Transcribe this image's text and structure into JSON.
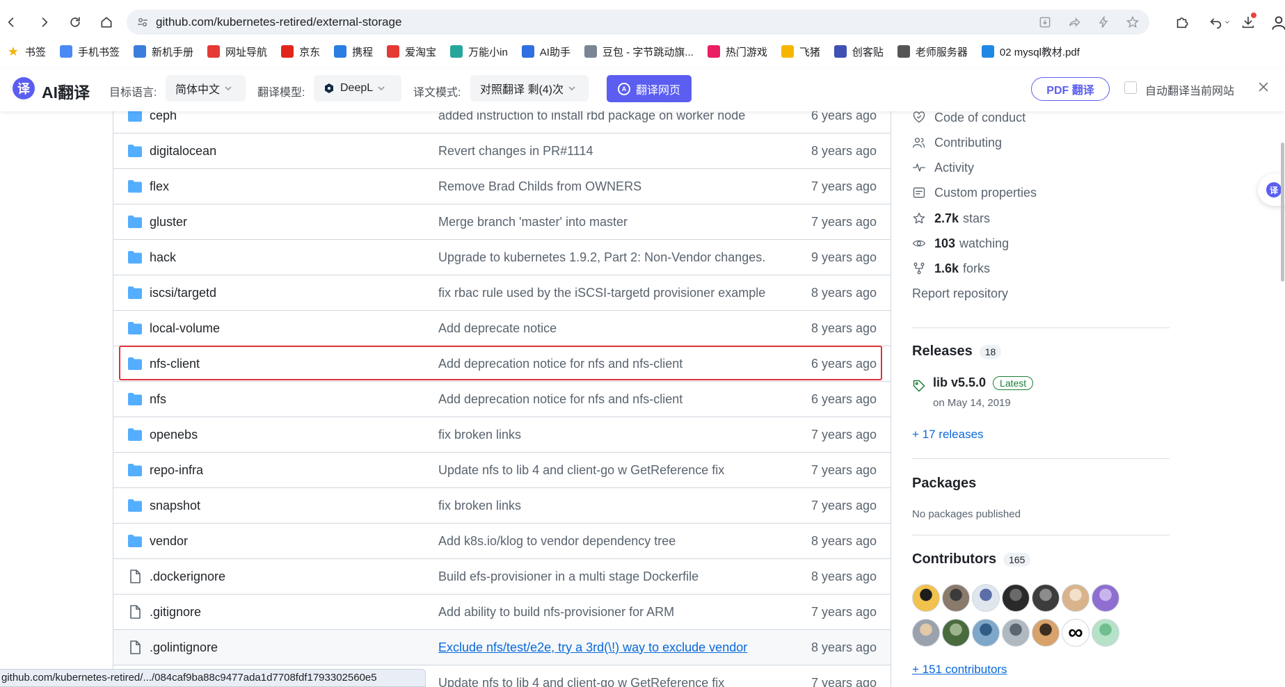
{
  "browser": {
    "url": "github.com/kubernetes-retired/external-storage",
    "status_url": "github.com/kubernetes-retired/.../084caf9ba88c9477ada1d7708fdf1793302560e5"
  },
  "bookmarks": [
    {
      "label": "书签",
      "icon": "star-icon",
      "color": "#f4b400"
    },
    {
      "label": "手机书签",
      "icon": "phone-bookmark-icon",
      "color": "#4a8af4"
    },
    {
      "label": "新机手册",
      "icon": "manual-icon",
      "color": "#3b7ddd"
    },
    {
      "label": "网址导航",
      "icon": "nav-icon",
      "color": "#e53935"
    },
    {
      "label": "京东",
      "icon": "jd-icon",
      "color": "#e1251b"
    },
    {
      "label": "携程",
      "icon": "ctrip-icon",
      "color": "#2a7de1"
    },
    {
      "label": "爱淘宝",
      "icon": "taobao-icon",
      "color": "#e53935"
    },
    {
      "label": "万能小in",
      "icon": "in-icon",
      "color": "#26a69a"
    },
    {
      "label": "AI助手",
      "icon": "ai-icon",
      "color": "#2f6fdf"
    },
    {
      "label": "豆包 - 字节跳动旗...",
      "icon": "doubao-icon",
      "color": "#7a8596"
    },
    {
      "label": "热门游戏",
      "icon": "game-icon",
      "color": "#e91e63"
    },
    {
      "label": "飞猪",
      "icon": "fliggy-icon",
      "color": "#f6b600"
    },
    {
      "label": "创客贴",
      "icon": "chuangke-icon",
      "color": "#3f51b5"
    },
    {
      "label": "老师服务器",
      "icon": "server-icon",
      "color": "#555555"
    },
    {
      "label": "02 mysql教材.pdf",
      "icon": "edge-icon",
      "color": "#1e88e5"
    }
  ],
  "translate": {
    "brand": "AI翻译",
    "target_lang_label": "目标语言:",
    "target_lang_value": "简体中文",
    "model_label": "翻译模型:",
    "model_value": "DeepL",
    "mode_label": "译文模式:",
    "mode_value": "对照翻译 剩(4)次",
    "translate_button": "翻译网页",
    "pdf_button": "PDF 翻译",
    "auto_label": "自动翻译当前网站",
    "accent": "#5b5ef0"
  },
  "files": [
    {
      "name": "ceph",
      "type": "folder",
      "message": "added instruction to install rbd package on worker node",
      "age": "6 years ago"
    },
    {
      "name": "digitalocean",
      "type": "folder",
      "message": "Revert changes in PR#1114",
      "age": "8 years ago"
    },
    {
      "name": "flex",
      "type": "folder",
      "message": "Remove Brad Childs from OWNERS",
      "age": "7 years ago"
    },
    {
      "name": "gluster",
      "type": "folder",
      "message": "Merge branch 'master' into master",
      "age": "7 years ago"
    },
    {
      "name": "hack",
      "type": "folder",
      "message": "Upgrade to kubernetes 1.9.2, Part 2: Non-Vendor changes.",
      "age": "9 years ago"
    },
    {
      "name": "iscsi/targetd",
      "type": "folder",
      "message": "fix rbac rule used by the iSCSI-targetd provisioner example",
      "age": "8 years ago"
    },
    {
      "name": "local-volume",
      "type": "folder",
      "message": "Add deprecate notice",
      "age": "8 years ago"
    },
    {
      "name": "nfs-client",
      "type": "folder",
      "message": "Add deprecation notice for nfs and nfs-client",
      "age": "6 years ago"
    },
    {
      "name": "nfs",
      "type": "folder",
      "message": "Add deprecation notice for nfs and nfs-client",
      "age": "6 years ago"
    },
    {
      "name": "openebs",
      "type": "folder",
      "message": "fix broken links",
      "age": "7 years ago"
    },
    {
      "name": "repo-infra",
      "type": "folder",
      "message": "Update nfs to lib 4 and client-go w GetReference fix",
      "age": "7 years ago"
    },
    {
      "name": "snapshot",
      "type": "folder",
      "message": "fix broken links",
      "age": "7 years ago"
    },
    {
      "name": "vendor",
      "type": "folder",
      "message": "Add k8s.io/klog to vendor dependency tree",
      "age": "8 years ago"
    },
    {
      "name": ".dockerignore",
      "type": "file",
      "message": "Build efs-provisioner in a multi stage Dockerfile",
      "age": "8 years ago"
    },
    {
      "name": ".gitignore",
      "type": "file",
      "message": "Add ability to build nfs-provisioner for ARM",
      "age": "7 years ago"
    },
    {
      "name": ".golintignore",
      "type": "file",
      "message": "Exclude nfs/test/e2e, try a 3rd(\\!) way to exclude vendor",
      "age": "8 years ago"
    },
    {
      "name": "",
      "type": "file",
      "message": "Update nfs to lib 4 and client-go w GetReference fix",
      "age": "7 years ago"
    }
  ],
  "sidebar": {
    "links": [
      {
        "label": "Code of conduct",
        "icon": "heart-shield-icon"
      },
      {
        "label": "Contributing",
        "icon": "people-icon"
      },
      {
        "label": "Activity",
        "icon": "pulse-icon"
      },
      {
        "label": "Custom properties",
        "icon": "note-icon"
      },
      {
        "label": "stars",
        "count": "2.7k",
        "icon": "star-icon"
      },
      {
        "label": "watching",
        "count": "103",
        "icon": "eye-icon"
      },
      {
        "label": "forks",
        "count": "1.6k",
        "icon": "fork-icon"
      }
    ],
    "report": "Report repository",
    "releases_title": "Releases",
    "releases_count": "18",
    "release_name": "lib v5.5.0",
    "release_badge": "Latest",
    "release_date": "on May 14, 2019",
    "more_releases": "+ 17 releases",
    "packages_title": "Packages",
    "packages_text": "No packages published",
    "contributors_title": "Contributors",
    "contributors_count": "165",
    "more_contributors": "+ 151 contributors"
  }
}
